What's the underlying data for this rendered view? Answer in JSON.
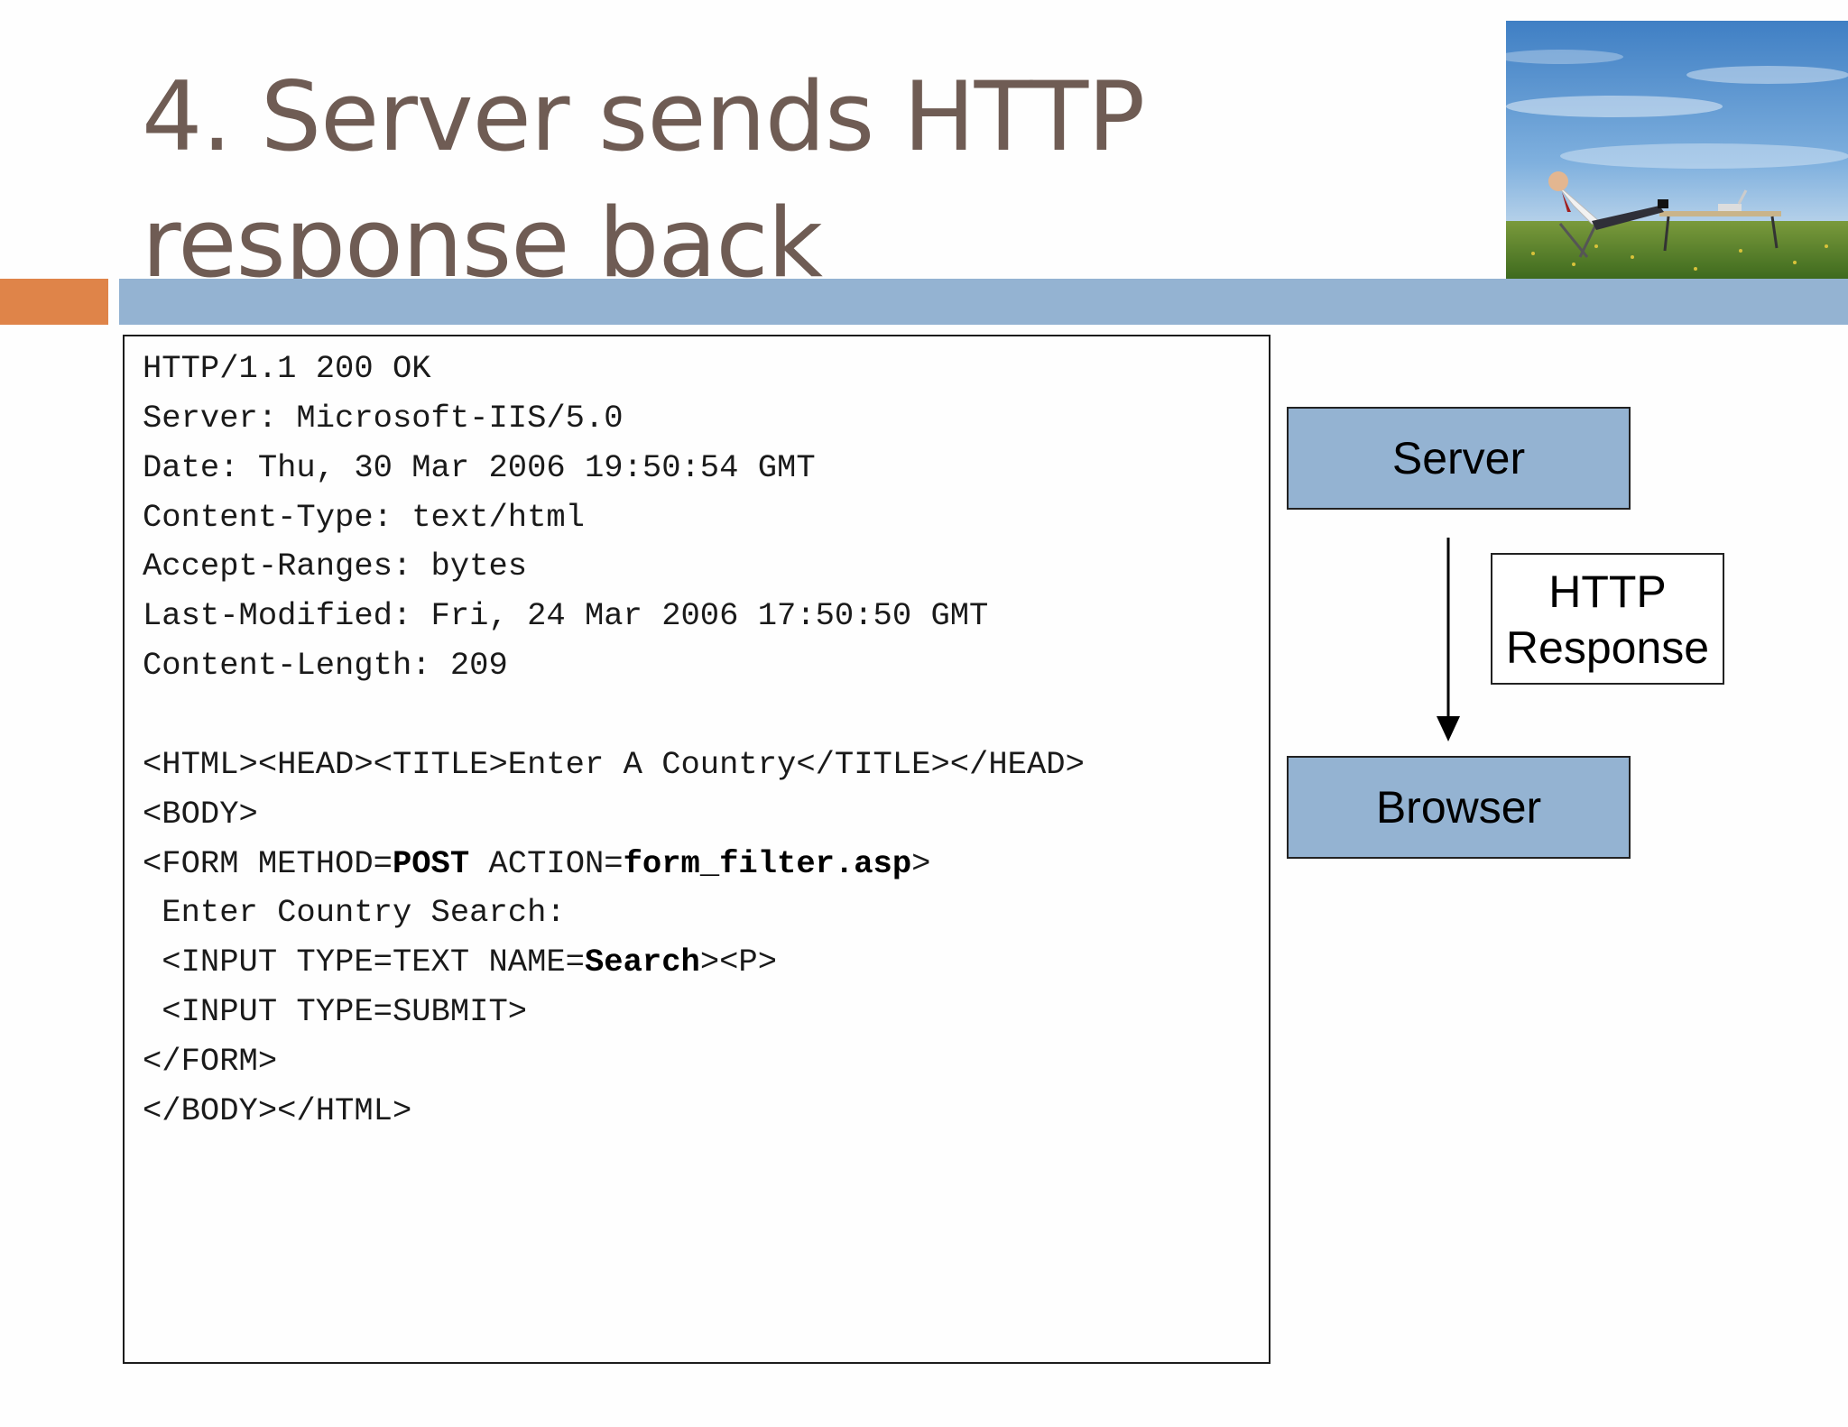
{
  "slide": {
    "title": "4. Server sends HTTP response back"
  },
  "response_code": {
    "lines": [
      [
        {
          "t": "HTTP/1.1 200 OK"
        }
      ],
      [
        {
          "t": "Server: Microsoft-IIS/5.0"
        }
      ],
      [
        {
          "t": "Date: Thu, 30 Mar 2006 19:50:54 GMT"
        }
      ],
      [
        {
          "t": "Content-Type: text/html"
        }
      ],
      [
        {
          "t": "Accept-Ranges: bytes"
        }
      ],
      [
        {
          "t": "Last-Modified: Fri, 24 Mar 2006 17:50:50 GMT"
        }
      ],
      [
        {
          "t": "Content-Length: 209"
        }
      ],
      [],
      [
        {
          "t": "<HTML><HEAD><TITLE>Enter A Country</TITLE></HEAD>"
        }
      ],
      [
        {
          "t": "<BODY>"
        }
      ],
      [
        {
          "t": "<FORM METHOD="
        },
        {
          "t": "POST",
          "b": true
        },
        {
          "t": " ACTION="
        },
        {
          "t": "form_filter.asp",
          "b": true
        },
        {
          "t": ">"
        }
      ],
      [
        {
          "t": " Enter Country Search:"
        }
      ],
      [
        {
          "t": " <INPUT TYPE=TEXT NAME="
        },
        {
          "t": "Search",
          "b": true
        },
        {
          "t": "><P>"
        }
      ],
      [
        {
          "t": " <INPUT TYPE=SUBMIT>"
        }
      ],
      [
        {
          "t": "</FORM>"
        }
      ],
      [
        {
          "t": "</BODY></HTML>"
        }
      ]
    ]
  },
  "diagram": {
    "server_label": "Server",
    "browser_label": "Browser",
    "arrow_label_line1": "HTTP",
    "arrow_label_line2": "Response"
  },
  "colors": {
    "title": "#6f5c54",
    "accent_orange": "#df8449",
    "accent_blue": "#94b3d2",
    "diagram_box": "#94b3d2"
  }
}
